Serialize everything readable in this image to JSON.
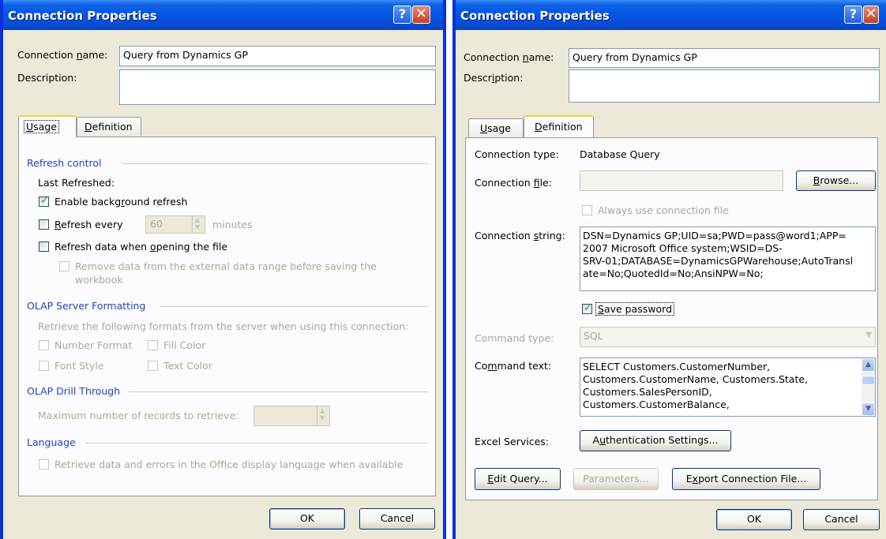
{
  "left": {
    "title": "Connection Properties",
    "help_glyph": "?",
    "close_glyph": "✕",
    "conn_name_label": "Connection name:",
    "conn_name_value": "Query from Dynamics GP",
    "description_label": "Description:",
    "description_value": "",
    "tabs": [
      "Usage",
      "Definition"
    ],
    "active_tab": "Usage",
    "refresh_section": "Refresh control",
    "last_refreshed_label": "Last Refreshed:",
    "enable_bg_refresh": {
      "label": "Enable background refresh",
      "checked": true
    },
    "refresh_every": {
      "label": "Refresh every",
      "value": "60",
      "unit": "minutes",
      "checked": false
    },
    "refresh_on_open": {
      "label": "Refresh data when opening the file",
      "checked": false
    },
    "remove_data": {
      "line1": "Remove data from the external data range before saving the",
      "line2": "workbook",
      "checked": false
    },
    "olap_format_section": "OLAP Server Formatting",
    "olap_format_desc": "Retrieve the following formats from the server when using this connection:",
    "formats": [
      "Number Format",
      "Fill Color",
      "Font Style",
      "Text Color"
    ],
    "drill_section": "OLAP Drill Through",
    "max_records_label": "Maximum number of records to retrieve:",
    "max_records_value": "",
    "language_section": "Language",
    "language_label": "Retrieve data and errors in the Office display language when available",
    "ok": "OK",
    "cancel": "Cancel"
  },
  "right": {
    "title": "Connection Properties",
    "help_glyph": "?",
    "close_glyph": "✕",
    "conn_name_label": "Connection name:",
    "conn_name_value": "Query from Dynamics GP",
    "description_label": "Description:",
    "description_value": "",
    "tabs": [
      "Usage",
      "Definition"
    ],
    "active_tab": "Definition",
    "conn_type_label": "Connection type:",
    "conn_type_value": "Database Query",
    "conn_file_label": "Connection file:",
    "conn_file_value": "",
    "browse": "Browse...",
    "always_use_file": {
      "label": "Always use connection file",
      "checked": false
    },
    "conn_string_label": "Connection string:",
    "conn_string_lines": [
      "DSN=Dynamics GP;UID=sa;PWD=pass@word1;APP=",
      "2007 Microsoft Office system;WSID=DS-",
      "SRV-01;DATABASE=DynamicsGPWarehouse;AutoTransl",
      "ate=No;QuotedId=No;AnsiNPW=No;"
    ],
    "save_password": {
      "label": "Save password",
      "checked": true
    },
    "command_type_label": "Command type:",
    "command_type_value": "SQL",
    "command_text_label": "Command text:",
    "command_text_lines": [
      "SELECT Customers.CustomerNumber,",
      "Customers.CustomerName, Customers.State,",
      "Customers.SalesPersonID,",
      "Customers.CustomerBalance,"
    ],
    "excel_services_label": "Excel Services:",
    "auth_settings": "Authentication Settings...",
    "edit_query": "Edit Query...",
    "parameters": "Parameters...",
    "export_file": "Export Connection File...",
    "ok": "OK",
    "cancel": "Cancel"
  }
}
